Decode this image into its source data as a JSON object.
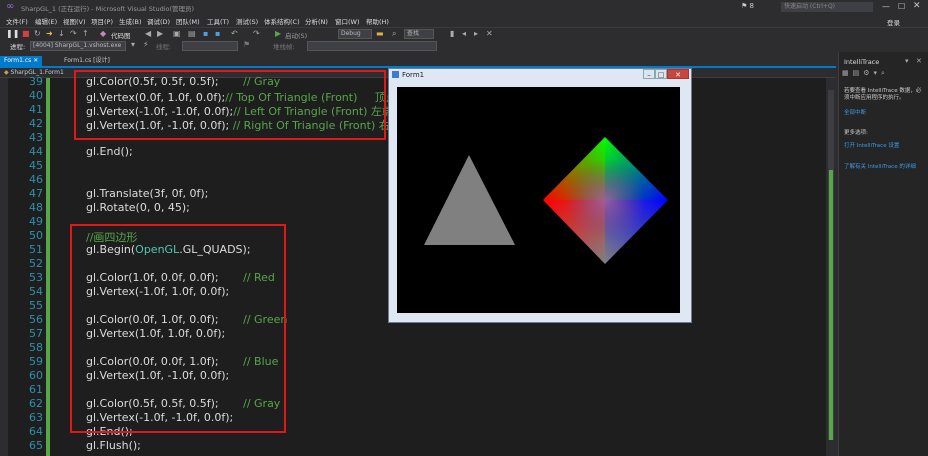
{
  "titlebar": {
    "title": "SharpGL_1 (正在运行) - Microsoft Visual Studio(管理员)",
    "notifications": "8",
    "quick_launch_placeholder": "快速启动 (Ctrl+Q)",
    "login": "登录"
  },
  "menu": [
    "文件(F)",
    "编辑(E)",
    "视图(V)",
    "项目(P)",
    "生成(B)",
    "调试(D)",
    "团队(M)",
    "工具(T)",
    "测试(S)",
    "体系结构(C)",
    "分析(N)",
    "窗口(W)",
    "帮助(H)"
  ],
  "toolbar": {
    "code_map": "代码图",
    "debug_target": "启动(S)",
    "config": "Debug",
    "search_placeholder": "查找"
  },
  "process_bar": {
    "label": "进程:",
    "process": "[4004] SharpGL_1.vshost.exe",
    "thread_label": "线程:",
    "stack_label": "堆栈帧:"
  },
  "tabs": [
    {
      "label": "Form1.cs",
      "active": true
    },
    {
      "label": "Form1.cs [设计]",
      "active": false
    }
  ],
  "nav": {
    "class": "SharpGL_1.Form1"
  },
  "code_lines": [
    {
      "n": "39",
      "parts": [
        {
          "t": "gl.Color(0.5f, 0.5f, 0.5f);       ",
          "c": ""
        },
        {
          "t": "// Gray",
          "c": "cmt"
        }
      ]
    },
    {
      "n": "40",
      "parts": [
        {
          "t": "gl.Vertex(0.0f, 1.0f, 0.0f);",
          "c": ""
        },
        {
          "t": "// Top Of Triangle (Front)     顶点",
          "c": "cmt"
        }
      ]
    },
    {
      "n": "41",
      "parts": [
        {
          "t": "gl.Vertex(-1.0f, -1.0f, 0.0f);",
          "c": ""
        },
        {
          "t": "// Left Of Triangle (Front) 左端点",
          "c": "cmt"
        }
      ]
    },
    {
      "n": "42",
      "parts": [
        {
          "t": "gl.Vertex(1.0f, -1.0f, 0.0f); ",
          "c": ""
        },
        {
          "t": "// Right Of Triangle (Front) 右端点",
          "c": "cmt"
        }
      ]
    },
    {
      "n": "43",
      "parts": []
    },
    {
      "n": "44",
      "parts": [
        {
          "t": "gl.End();",
          "c": ""
        }
      ]
    },
    {
      "n": "45",
      "parts": []
    },
    {
      "n": "46",
      "parts": []
    },
    {
      "n": "47",
      "parts": [
        {
          "t": "gl.Translate(3f, 0f, 0f);",
          "c": ""
        }
      ]
    },
    {
      "n": "48",
      "parts": [
        {
          "t": "gl.Rotate(0, 0, 45);",
          "c": ""
        }
      ]
    },
    {
      "n": "49",
      "parts": []
    },
    {
      "n": "50",
      "parts": [
        {
          "t": "//画四边形",
          "c": "cmt"
        }
      ]
    },
    {
      "n": "51",
      "parts": [
        {
          "t": "gl.Begin(",
          "c": ""
        },
        {
          "t": "OpenGL",
          "c": "type"
        },
        {
          "t": ".GL_QUADS);",
          "c": ""
        }
      ]
    },
    {
      "n": "52",
      "parts": []
    },
    {
      "n": "53",
      "parts": [
        {
          "t": "gl.Color(1.0f, 0.0f, 0.0f);       ",
          "c": ""
        },
        {
          "t": "// Red",
          "c": "cmt"
        }
      ]
    },
    {
      "n": "54",
      "parts": [
        {
          "t": "gl.Vertex(-1.0f, 1.0f, 0.0f);",
          "c": ""
        }
      ]
    },
    {
      "n": "55",
      "parts": []
    },
    {
      "n": "56",
      "parts": [
        {
          "t": "gl.Color(0.0f, 1.0f, 0.0f);       ",
          "c": ""
        },
        {
          "t": "// Green",
          "c": "cmt"
        }
      ]
    },
    {
      "n": "57",
      "parts": [
        {
          "t": "gl.Vertex(1.0f, 1.0f, 0.0f);",
          "c": ""
        }
      ]
    },
    {
      "n": "58",
      "parts": []
    },
    {
      "n": "59",
      "parts": [
        {
          "t": "gl.Color(0.0f, 0.0f, 1.0f);       ",
          "c": ""
        },
        {
          "t": "// Blue",
          "c": "cmt"
        }
      ]
    },
    {
      "n": "60",
      "parts": [
        {
          "t": "gl.Vertex(1.0f, -1.0f, 0.0f);",
          "c": ""
        }
      ]
    },
    {
      "n": "61",
      "parts": []
    },
    {
      "n": "62",
      "parts": [
        {
          "t": "gl.Color(0.5f, 0.5f, 0.5f);       ",
          "c": ""
        },
        {
          "t": "// Gray",
          "c": "cmt"
        }
      ]
    },
    {
      "n": "63",
      "parts": [
        {
          "t": "gl.Vertex(-1.0f, -1.0f, 0.0f);",
          "c": ""
        }
      ]
    },
    {
      "n": "64",
      "parts": [
        {
          "t": "gl.End();",
          "c": ""
        }
      ]
    },
    {
      "n": "65",
      "parts": [
        {
          "t": "gl.Flush();",
          "c": ""
        }
      ]
    }
  ],
  "form": {
    "title": "Form1"
  },
  "right_panel": {
    "title": "IntelliTrace",
    "desc": "若要查看 IntelliTrace 数据，必须中断应用程序的执行。",
    "break_link": "全部中断",
    "more_options": "更多选项:",
    "open_settings": "打开 IntelliTrace 设置",
    "learn_more": "了解有关 IntelliTrace 的详细"
  },
  "colors": {
    "accent": "#007acc",
    "comment": "#57a64a",
    "line_number": "#2b91af",
    "highlight_box": "#e01818"
  }
}
